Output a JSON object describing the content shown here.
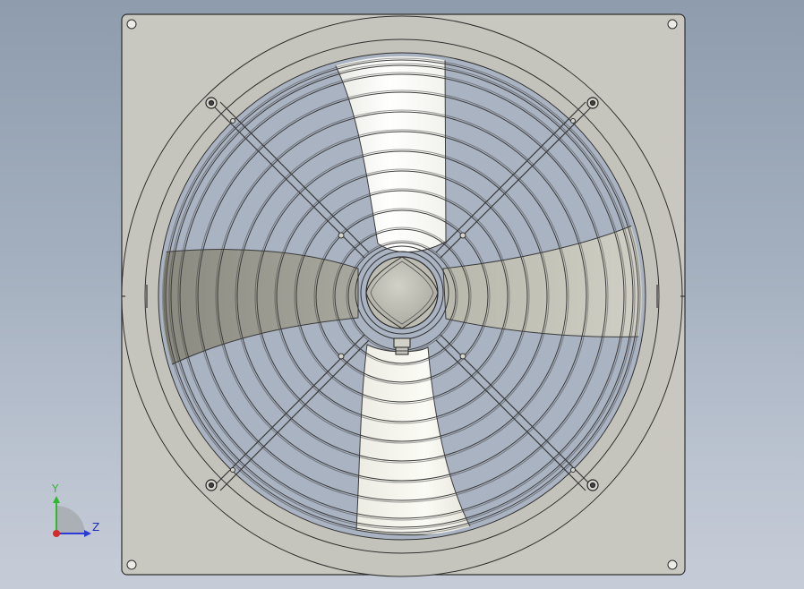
{
  "viewport": {
    "background_top": "#8e9cae",
    "background_bottom": "#c6ccd7"
  },
  "model": {
    "panel_color": "#c9c8c0",
    "edge_color": "#2f2f2f",
    "blade_light": "#f4f4ee",
    "blade_mid": "#c2c1b6",
    "blade_dark": "#8f8e85",
    "opening_color": "#aab3c2"
  },
  "triad": {
    "y_label": "Y",
    "z_label": "Z",
    "y_color": "#2db82d",
    "z_color": "#2b3bd6",
    "x_color": "#d42a2a",
    "icon": "view-orientation-triad-icon"
  }
}
